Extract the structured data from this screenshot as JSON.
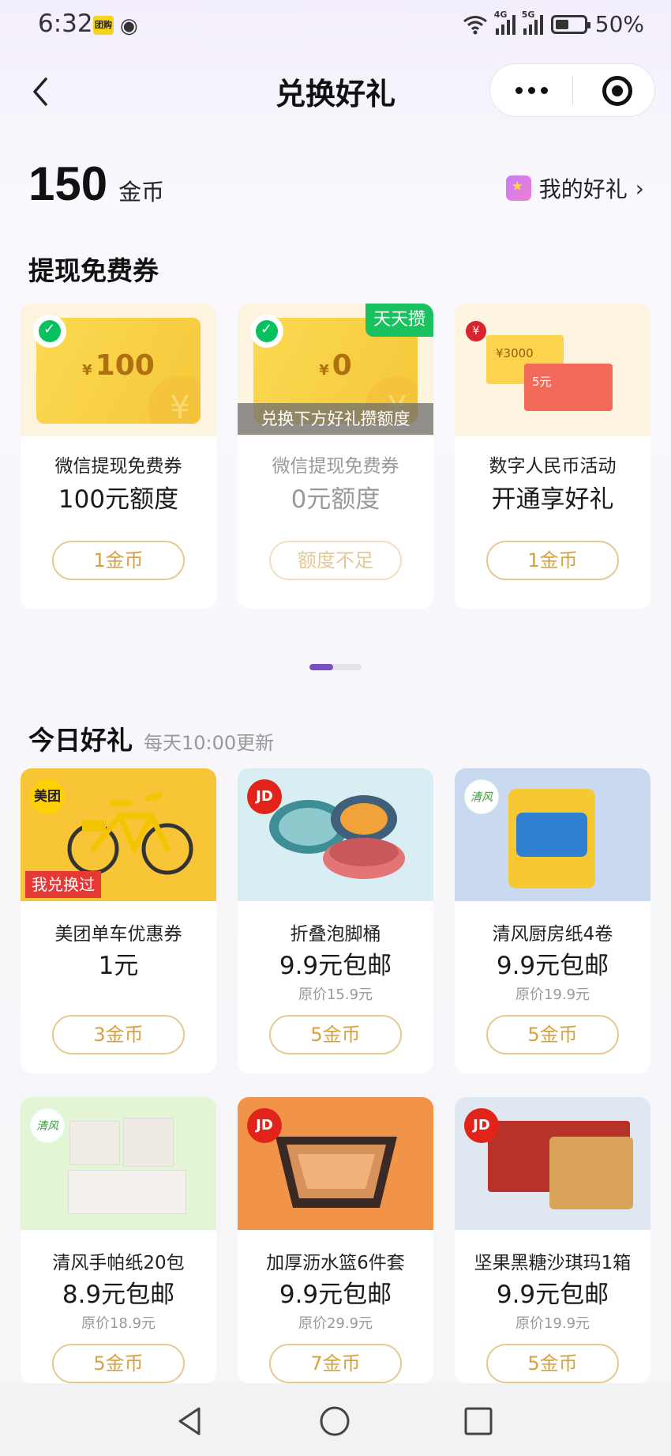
{
  "status_bar": {
    "time": "6:32",
    "battery": "50%",
    "net1": "4G",
    "net2": "5G",
    "app_badge": "团购"
  },
  "nav": {
    "title": "兑换好礼"
  },
  "coins": {
    "amount": "150",
    "unit": "金币"
  },
  "my_gifts": {
    "label": "我的好礼"
  },
  "coupons": {
    "title": "提现免费券",
    "items": [
      {
        "voucher_amount": "100",
        "currency": "¥",
        "name": "微信提现免费券",
        "value": "100元额度",
        "button": "1金币"
      },
      {
        "voucher_amount": "0",
        "currency": "¥",
        "tag": "天天攒",
        "overlay": "兑换下方好礼攒额度",
        "name": "微信提现免费券",
        "value": "0元额度",
        "button": "额度不足"
      },
      {
        "card1": "¥3000",
        "card2": "5元",
        "name": "数字人民币活动",
        "value": "开通享好礼",
        "button": "1金币"
      }
    ]
  },
  "pager": {
    "active_index": 0,
    "count": 2
  },
  "daily": {
    "title": "今日好礼",
    "subtitle": "每天10:00更新",
    "items": [
      {
        "logo": "美团",
        "badge": "我兑换过",
        "name": "美团单车优惠券",
        "price": "1元",
        "original": "",
        "button": "3金币",
        "bg": "#f8c536"
      },
      {
        "logo": "JD",
        "name": "折叠泡脚桶",
        "price": "9.9元包邮",
        "original": "原价15.9元",
        "button": "5金币",
        "bg": "#d8eef3"
      },
      {
        "logo": "清风",
        "name": "清风厨房纸4卷",
        "price": "9.9元包邮",
        "original": "原价19.9元",
        "button": "5金币",
        "bg": "#c9d9ef"
      },
      {
        "logo": "清风",
        "name": "清风手帕纸20包",
        "price": "8.9元包邮",
        "original": "原价18.9元",
        "button": "5金币",
        "bg": "#e3f5d4"
      },
      {
        "logo": "JD",
        "name": "加厚沥水篮6件套",
        "price": "9.9元包邮",
        "original": "原价29.9元",
        "button": "7金币",
        "bg": "#f2934a"
      },
      {
        "logo": "JD",
        "name": "坚果黑糖沙琪玛1箱",
        "price": "9.9元包邮",
        "original": "原价19.9元",
        "button": "5金币",
        "bg": "#dfe7f1"
      }
    ]
  },
  "colors": {
    "accent_gold": "#d9a040",
    "wechat_green": "#07c160",
    "pager_active": "#7b4fc4"
  }
}
